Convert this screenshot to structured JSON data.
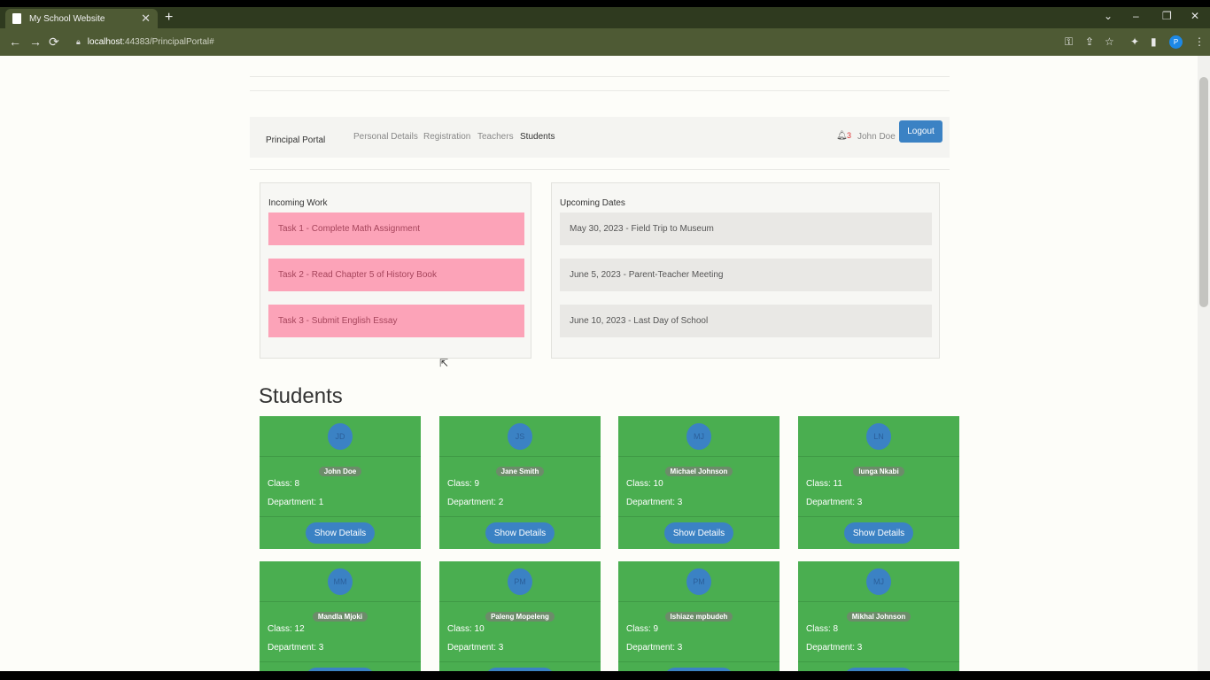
{
  "browser": {
    "tab_title": "My School Website",
    "tab_close": "✕",
    "new_tab": "+",
    "url_host": "localhost",
    "url_rest": ":44383/PrincipalPortal#",
    "win_controls": [
      "⌄",
      "–",
      "❐",
      "✕"
    ],
    "nav": {
      "back": "←",
      "forward": "→",
      "reload": "⟳"
    }
  },
  "appnav": {
    "brand": "Principal Portal",
    "links": [
      "Personal Details",
      "Registration",
      "Teachers",
      "Students"
    ],
    "notification_count": "3",
    "user": "John Doe",
    "logout": "Logout"
  },
  "incoming_work": {
    "title": "Incoming Work",
    "items": [
      "Task 1 - Complete Math Assignment",
      "Task 2 - Read Chapter 5 of History Book",
      "Task 3 - Submit English Essay"
    ]
  },
  "upcoming_dates": {
    "title": "Upcoming Dates",
    "items": [
      "May 30, 2023 - Field Trip to Museum",
      "June 5, 2023 - Parent-Teacher Meeting",
      "June 10, 2023 - Last Day of School"
    ]
  },
  "students": {
    "heading": "Students",
    "button_label": "Show Details",
    "cards": [
      {
        "initials": "JD",
        "name": "John Doe",
        "class": "Class: 8",
        "department": "Department: 1"
      },
      {
        "initials": "JS",
        "name": "Jane Smith",
        "class": "Class: 9",
        "department": "Department: 2"
      },
      {
        "initials": "MJ",
        "name": "Michael Johnson",
        "class": "Class: 10",
        "department": "Department: 3"
      },
      {
        "initials": "LN",
        "name": "lunga Nkabi",
        "class": "Class: 11",
        "department": "Department: 3"
      },
      {
        "initials": "MM",
        "name": "Mandla Mjoki",
        "class": "Class: 12",
        "department": "Department: 3"
      },
      {
        "initials": "PM",
        "name": "Paleng Mopeleng",
        "class": "Class: 10",
        "department": "Department: 3"
      },
      {
        "initials": "PM",
        "name": "Ishiaze mpbudeh",
        "class": "Class: 9",
        "department": "Department: 3"
      },
      {
        "initials": "MJ",
        "name": "Mikhal Johnson",
        "class": "Class: 8",
        "department": "Department: 3"
      }
    ]
  }
}
